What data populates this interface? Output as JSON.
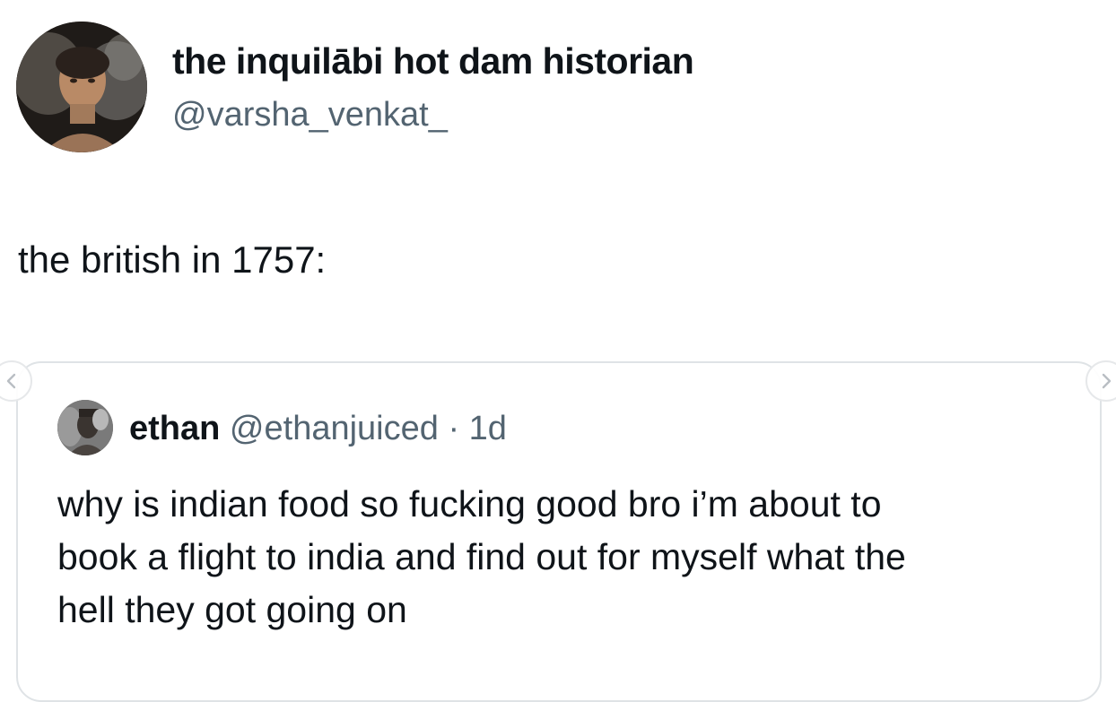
{
  "tweet": {
    "author": {
      "display_name": "the inquilābi hot dam historian",
      "handle": "@varsha_venkat_"
    },
    "text": "the british in 1757:"
  },
  "quoted_tweet": {
    "author": {
      "display_name": "ethan",
      "handle": "@ethanjuiced",
      "separator": " · ",
      "time": "1d"
    },
    "text_lines": [
      "why is indian food so fucking good bro i’m about to",
      "book a flight to india and find out for myself what the",
      "hell they got going on"
    ]
  },
  "navigation": {
    "prev_icon": "chevron-left-icon",
    "next_icon": "chevron-right-icon"
  },
  "colors": {
    "text_primary": "#0f1419",
    "text_secondary": "#536471",
    "card_border": "#dfe3e6",
    "background": "#ffffff"
  }
}
